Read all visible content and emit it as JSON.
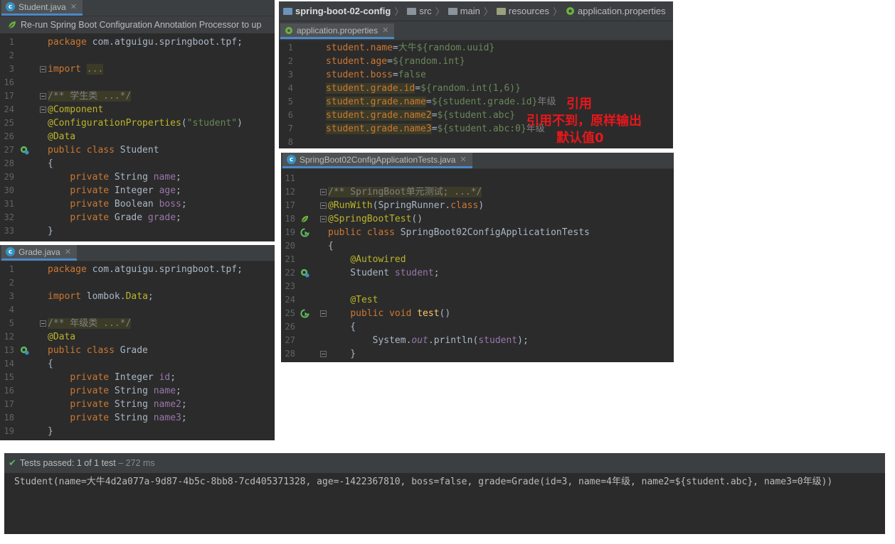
{
  "student_panel": {
    "tab_label": "Student.java",
    "notice": "Re-run Spring Boot Configuration Annotation Processor to up",
    "lines": [
      {
        "n": "1",
        "html": "<span class=\"kw\">package</span> com.atguigu.springboot.tpf;",
        "fold": false,
        "icon": ""
      },
      {
        "n": "2",
        "html": "",
        "fold": false,
        "icon": ""
      },
      {
        "n": "3",
        "html": "<span class=\"kw\">import</span> <span class=\"cm hl\">...</span>",
        "fold": true,
        "icon": ""
      },
      {
        "n": "16",
        "html": "",
        "fold": false,
        "icon": ""
      },
      {
        "n": "17",
        "html": "<span class=\"cm hl\">/** 学生类 ...*/</span>",
        "fold": true,
        "icon": ""
      },
      {
        "n": "24",
        "html": "<span class=\"an\">@Component</span>",
        "fold": true,
        "icon": ""
      },
      {
        "n": "25",
        "html": "<span class=\"an\">@ConfigurationProperties</span>(<span class=\"st\">\"student\"</span>)",
        "fold": false,
        "icon": ""
      },
      {
        "n": "26",
        "html": "<span class=\"an\">@Data</span>",
        "fold": false,
        "icon": ""
      },
      {
        "n": "27",
        "html": "<span class=\"kw\">public class</span> Student",
        "fold": false,
        "icon": "bean"
      },
      {
        "n": "28",
        "html": "{",
        "fold": false,
        "icon": ""
      },
      {
        "n": "29",
        "html": "    <span class=\"kw\">private</span> String <span class=\"fd\">name</span>;",
        "fold": false,
        "icon": ""
      },
      {
        "n": "30",
        "html": "    <span class=\"kw\">private</span> Integer <span class=\"fd\">age</span>;",
        "fold": false,
        "icon": ""
      },
      {
        "n": "31",
        "html": "    <span class=\"kw\">private</span> Boolean <span class=\"fd\">boss</span>;",
        "fold": false,
        "icon": ""
      },
      {
        "n": "32",
        "html": "    <span class=\"kw\">private</span> Grade <span class=\"fd\">grade</span>;",
        "fold": false,
        "icon": ""
      },
      {
        "n": "33",
        "html": "}",
        "fold": false,
        "icon": ""
      }
    ]
  },
  "grade_panel": {
    "tab_label": "Grade.java",
    "lines": [
      {
        "n": "1",
        "html": "<span class=\"kw\">package</span> com.atguigu.springboot.tpf;",
        "fold": false,
        "icon": ""
      },
      {
        "n": "2",
        "html": "",
        "fold": false,
        "icon": ""
      },
      {
        "n": "3",
        "html": "<span class=\"kw\">import</span> lombok.<span class=\"an\">Data</span>;",
        "fold": false,
        "icon": ""
      },
      {
        "n": "4",
        "html": "",
        "fold": false,
        "icon": ""
      },
      {
        "n": "5",
        "html": "<span class=\"cm hl\">/** 年级类 ...*/</span>",
        "fold": true,
        "icon": ""
      },
      {
        "n": "12",
        "html": "<span class=\"an\">@Data</span>",
        "fold": false,
        "icon": ""
      },
      {
        "n": "13",
        "html": "<span class=\"kw\">public class</span> Grade",
        "fold": false,
        "icon": "bean"
      },
      {
        "n": "14",
        "html": "{",
        "fold": false,
        "icon": ""
      },
      {
        "n": "15",
        "html": "    <span class=\"kw\">private</span> Integer <span class=\"fd\">id</span>;",
        "fold": false,
        "icon": ""
      },
      {
        "n": "16",
        "html": "    <span class=\"kw\">private</span> String <span class=\"fd\">name</span>;",
        "fold": false,
        "icon": ""
      },
      {
        "n": "17",
        "html": "    <span class=\"kw\">private</span> String <span class=\"fd\">name2</span>;",
        "fold": false,
        "icon": ""
      },
      {
        "n": "18",
        "html": "    <span class=\"kw\">private</span> String <span class=\"fd\">name3</span>;",
        "fold": false,
        "icon": ""
      },
      {
        "n": "19",
        "html": "}",
        "fold": false,
        "icon": ""
      }
    ]
  },
  "props_panel": {
    "breadcrumb": [
      "spring-boot-02-config",
      "src",
      "main",
      "resources",
      "application.properties"
    ],
    "tab_label": "application.properties",
    "lines": [
      {
        "n": "1",
        "html": "<span class=\"pk\">student.name</span>=<span class=\"pv\">大牛${random.uuid}</span>"
      },
      {
        "n": "2",
        "html": "<span class=\"pk\">student.age</span>=<span class=\"pv\">${random.int}</span>"
      },
      {
        "n": "3",
        "html": "<span class=\"pk\">student.boss</span>=<span class=\"pv\">false</span>"
      },
      {
        "n": "4",
        "html": "<span class=\"pk hl\">student.grade.id</span>=<span class=\"pv\">${random.int(1,6)}</span>"
      },
      {
        "n": "5",
        "html": "<span class=\"pk hl\">student.grade.name</span>=<span class=\"pv\">${student.grade.id}</span><span class=\"cm\">年级</span>"
      },
      {
        "n": "6",
        "html": "<span class=\"pk hl\">student.grade.name2</span>=<span class=\"pv\">${student.abc}</span>"
      },
      {
        "n": "7",
        "html": "<span class=\"pk hl\">student.grade.name3</span>=<span class=\"pv\">${student.abc:0}</span><span class=\"cm\">年级</span>"
      },
      {
        "n": "8",
        "html": ""
      }
    ],
    "annotations": {
      "ref": "引用",
      "not_found": "引用不到，原样输出",
      "default": "默认值0"
    }
  },
  "tests_panel": {
    "tab_label": "SpringBoot02ConfigApplicationTests.java",
    "lines": [
      {
        "n": "11",
        "html": "",
        "fold": false,
        "icon": ""
      },
      {
        "n": "12",
        "html": "<span class=\"cm hl\">/** SpringBoot单元测试; ...*/</span>",
        "fold": true,
        "icon": ""
      },
      {
        "n": "17",
        "html": "<span class=\"an\">@RunWith</span>(SpringRunner.<span class=\"kw\">class</span>)",
        "fold": true,
        "icon": ""
      },
      {
        "n": "18",
        "html": "<span class=\"an\">@SpringBootTest</span>()",
        "fold": true,
        "icon": "leaf"
      },
      {
        "n": "19",
        "html": "<span class=\"kw\">public class</span> SpringBoot02ConfigApplicationTests",
        "fold": false,
        "icon": "run"
      },
      {
        "n": "20",
        "html": "{",
        "fold": false,
        "icon": ""
      },
      {
        "n": "21",
        "html": "    <span class=\"an\">@Autowired</span>",
        "fold": false,
        "icon": ""
      },
      {
        "n": "22",
        "html": "    Student <span class=\"fd\">student</span>;",
        "fold": false,
        "icon": "bean"
      },
      {
        "n": "23",
        "html": "",
        "fold": false,
        "icon": ""
      },
      {
        "n": "24",
        "html": "    <span class=\"an\">@Test</span>",
        "fold": false,
        "icon": ""
      },
      {
        "n": "25",
        "html": "    <span class=\"kw\">public void</span> <span style=\"color:#ffc66d\">test</span>()",
        "fold": true,
        "icon": "run"
      },
      {
        "n": "26",
        "html": "    {",
        "fold": false,
        "icon": ""
      },
      {
        "n": "27",
        "html": "        System.<span class=\"fd it\">out</span>.println(<span class=\"fd\">student</span>);",
        "fold": false,
        "icon": ""
      },
      {
        "n": "28",
        "html": "    }",
        "fold": true,
        "icon": ""
      }
    ]
  },
  "test_results": {
    "status": "Tests passed:",
    "count": "1",
    "of": "of 1 test",
    "time": "– 272 ms",
    "output": "Student(name=大牛4d2a077a-9d87-4b5c-8bb8-7cd405371328, age=-1422367810, boss=false, grade=Grade(id=3, name=4年级, name2=${student.abc}, name3=0年级))"
  }
}
